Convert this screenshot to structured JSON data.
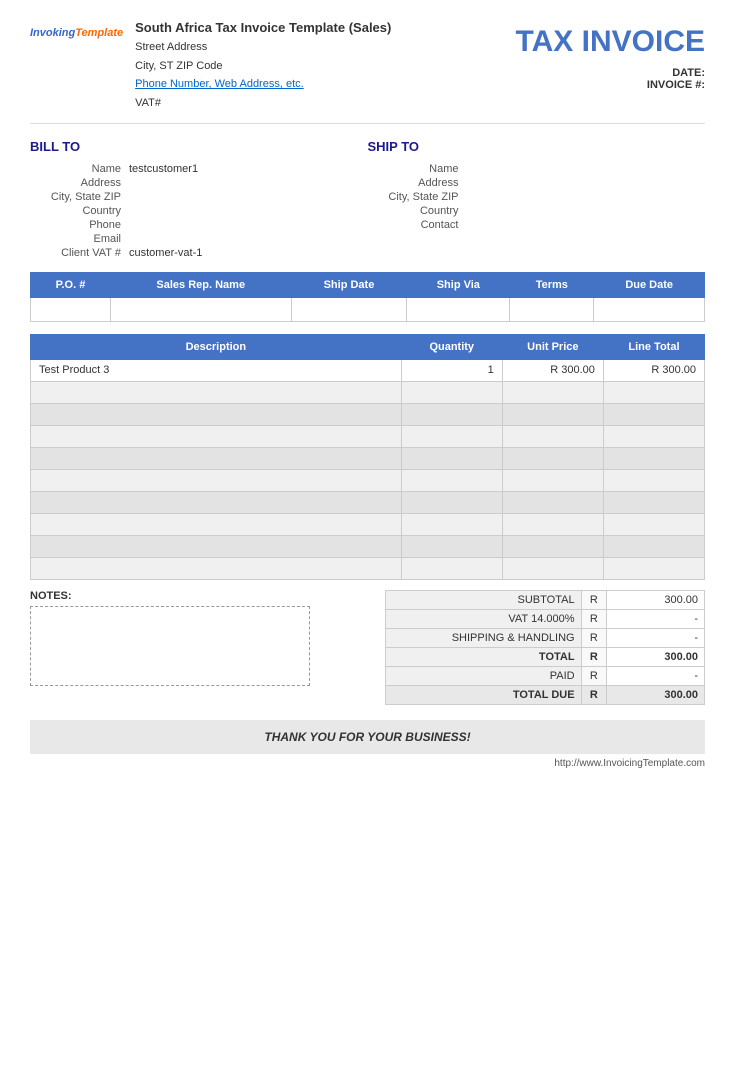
{
  "header": {
    "logo_inv": "Invoking",
    "logo_template": "Template",
    "company_name": "South Africa Tax Invoice Template (Sales)",
    "street_address": "Street Address",
    "city_state_zip": "City, ST  ZIP Code",
    "phone_web": "Phone Number, Web Address, etc.",
    "vat": "VAT#",
    "tax_invoice_title": "TAX INVOICE",
    "date_label": "DATE:",
    "date_value": "",
    "invoice_label": "INVOICE #:",
    "invoice_value": ""
  },
  "bill_to": {
    "title": "BILL TO",
    "name_label": "Name",
    "name_value": "testcustomer1",
    "address_label": "Address",
    "address_value": "",
    "city_label": "City, State ZIP",
    "city_value": "",
    "country_label": "Country",
    "country_value": "",
    "phone_label": "Phone",
    "phone_value": "",
    "email_label": "Email",
    "email_value": "",
    "vat_label": "Client VAT #",
    "vat_value": "customer-vat-1"
  },
  "ship_to": {
    "title": "SHIP TO",
    "name_label": "Name",
    "name_value": "",
    "address_label": "Address",
    "address_value": "",
    "city_label": "City, State ZIP",
    "city_value": "",
    "country_label": "Country",
    "country_value": "",
    "contact_label": "Contact",
    "contact_value": ""
  },
  "po_table": {
    "headers": [
      "P.O. #",
      "Sales Rep. Name",
      "Ship Date",
      "Ship Via",
      "Terms",
      "Due Date"
    ]
  },
  "items_table": {
    "headers": {
      "description": "Description",
      "quantity": "Quantity",
      "unit_price": "Unit Price",
      "line_total": "Line Total"
    },
    "rows": [
      {
        "description": "Test Product 3",
        "quantity": "1",
        "unit_price": "R 300.00",
        "line_total": "R 300.00"
      },
      {
        "description": "",
        "quantity": "",
        "unit_price": "",
        "line_total": ""
      },
      {
        "description": "",
        "quantity": "",
        "unit_price": "",
        "line_total": ""
      },
      {
        "description": "",
        "quantity": "",
        "unit_price": "",
        "line_total": ""
      },
      {
        "description": "",
        "quantity": "",
        "unit_price": "",
        "line_total": ""
      },
      {
        "description": "",
        "quantity": "",
        "unit_price": "",
        "line_total": ""
      },
      {
        "description": "",
        "quantity": "",
        "unit_price": "",
        "line_total": ""
      },
      {
        "description": "",
        "quantity": "",
        "unit_price": "",
        "line_total": ""
      },
      {
        "description": "",
        "quantity": "",
        "unit_price": "",
        "line_total": ""
      },
      {
        "description": "",
        "quantity": "",
        "unit_price": "",
        "line_total": ""
      }
    ]
  },
  "totals": {
    "subtotal_label": "SUBTOTAL",
    "subtotal_currency": "R",
    "subtotal_value": "300.00",
    "vat_label": "VAT",
    "vat_rate": "14.000%",
    "vat_currency": "R",
    "vat_value": "-",
    "shipping_label": "SHIPPING & HANDLING",
    "shipping_currency": "R",
    "shipping_value": "-",
    "total_label": "TOTAL",
    "total_currency": "R",
    "total_value": "300.00",
    "paid_label": "PAID",
    "paid_currency": "R",
    "paid_value": "-",
    "total_due_label": "TOTAL DUE",
    "total_due_currency": "R",
    "total_due_value": "300.00"
  },
  "notes": {
    "label": "NOTES:",
    "value": ""
  },
  "footer": {
    "thank_you": "THANK YOU FOR YOUR BUSINESS!",
    "url": "http://www.InvoicingTemplate.com"
  }
}
